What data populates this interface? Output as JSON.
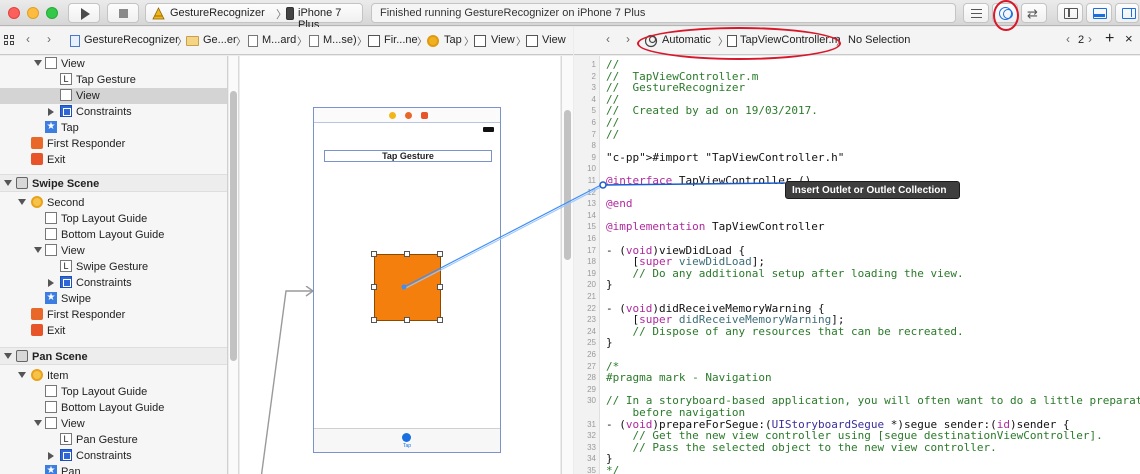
{
  "toolbar": {
    "scheme_name": "GestureRecognizer",
    "scheme_sep": "〉",
    "device": "iPhone 7 Plus",
    "activity": "Finished running GestureRecognizer on iPhone 7 Plus"
  },
  "left_jumpbar": {
    "items": [
      "GestureRecognizer",
      "Ge...er",
      "M...ard",
      "M...se)",
      "Fir...ne",
      "Tap",
      "View",
      "View"
    ]
  },
  "right_jumpbar": {
    "mode": "Automatic",
    "file": "TapViewController.m",
    "selection": "No Selection",
    "counter": "2"
  },
  "outline": {
    "rows": [
      {
        "label": "View"
      },
      {
        "label": "Tap Gesture"
      },
      {
        "label": "View"
      },
      {
        "label": "Constraints"
      },
      {
        "label": "Tap"
      },
      {
        "label": "First Responder"
      },
      {
        "label": "Exit"
      },
      {
        "label": "Swipe Scene"
      },
      {
        "label": "Second"
      },
      {
        "label": "Top Layout Guide"
      },
      {
        "label": "Bottom Layout Guide"
      },
      {
        "label": "View"
      },
      {
        "label": "Swipe Gesture"
      },
      {
        "label": "Constraints"
      },
      {
        "label": "Swipe"
      },
      {
        "label": "First Responder"
      },
      {
        "label": "Exit"
      },
      {
        "label": "Pan Scene"
      },
      {
        "label": "Item"
      },
      {
        "label": "Top Layout Guide"
      },
      {
        "label": "Bottom Layout Guide"
      },
      {
        "label": "View"
      },
      {
        "label": "Pan Gesture"
      },
      {
        "label": "Constraints"
      },
      {
        "label": "Pan"
      }
    ]
  },
  "canvas": {
    "label_text": "Tap Gesture",
    "tab_label": "Tap"
  },
  "code": {
    "lines": [
      {
        "n": "1",
        "t": "//"
      },
      {
        "n": "2",
        "t": "//  TapViewController.m"
      },
      {
        "n": "3",
        "t": "//  GestureRecognizer"
      },
      {
        "n": "4",
        "t": "//"
      },
      {
        "n": "5",
        "t": "//  Created by ad on 19/03/2017."
      },
      {
        "n": "6",
        "t": "//"
      },
      {
        "n": "7",
        "t": "//"
      },
      {
        "n": "8",
        "t": ""
      },
      {
        "n": "9",
        "t": "#import \"TapViewController.h\""
      },
      {
        "n": "10",
        "t": ""
      },
      {
        "n": "11",
        "t": "@interface TapViewController ()"
      },
      {
        "n": "12",
        "t": ""
      },
      {
        "n": "13",
        "t": "@end"
      },
      {
        "n": "14",
        "t": ""
      },
      {
        "n": "15",
        "t": "@implementation TapViewController"
      },
      {
        "n": "16",
        "t": ""
      },
      {
        "n": "17",
        "t": "- (void)viewDidLoad {"
      },
      {
        "n": "18",
        "t": "    [super viewDidLoad];"
      },
      {
        "n": "19",
        "t": "    // Do any additional setup after loading the view."
      },
      {
        "n": "20",
        "t": "}"
      },
      {
        "n": "21",
        "t": ""
      },
      {
        "n": "22",
        "t": "- (void)didReceiveMemoryWarning {"
      },
      {
        "n": "23",
        "t": "    [super didReceiveMemoryWarning];"
      },
      {
        "n": "24",
        "t": "    // Dispose of any resources that can be recreated."
      },
      {
        "n": "25",
        "t": "}"
      },
      {
        "n": "26",
        "t": ""
      },
      {
        "n": "27",
        "t": "/*"
      },
      {
        "n": "28",
        "t": "#pragma mark - Navigation"
      },
      {
        "n": "29",
        "t": ""
      },
      {
        "n": "30",
        "t": "// In a storyboard-based application, you will often want to do a little preparation"
      },
      {
        "n": "",
        "t": "    before navigation"
      },
      {
        "n": "31",
        "t": "- (void)prepareForSegue:(UIStoryboardSegue *)segue sender:(id)sender {"
      },
      {
        "n": "32",
        "t": "    // Get the new view controller using [segue destinationViewController]."
      },
      {
        "n": "33",
        "t": "    // Pass the selected object to the new view controller."
      },
      {
        "n": "34",
        "t": "}"
      },
      {
        "n": "35",
        "t": "*/"
      }
    ]
  },
  "tooltip": "Insert Outlet or Outlet Collection",
  "colors": {
    "accent": "#1a6fe0",
    "annotation": "#d8182a",
    "orange_view": "#f57f0d"
  }
}
